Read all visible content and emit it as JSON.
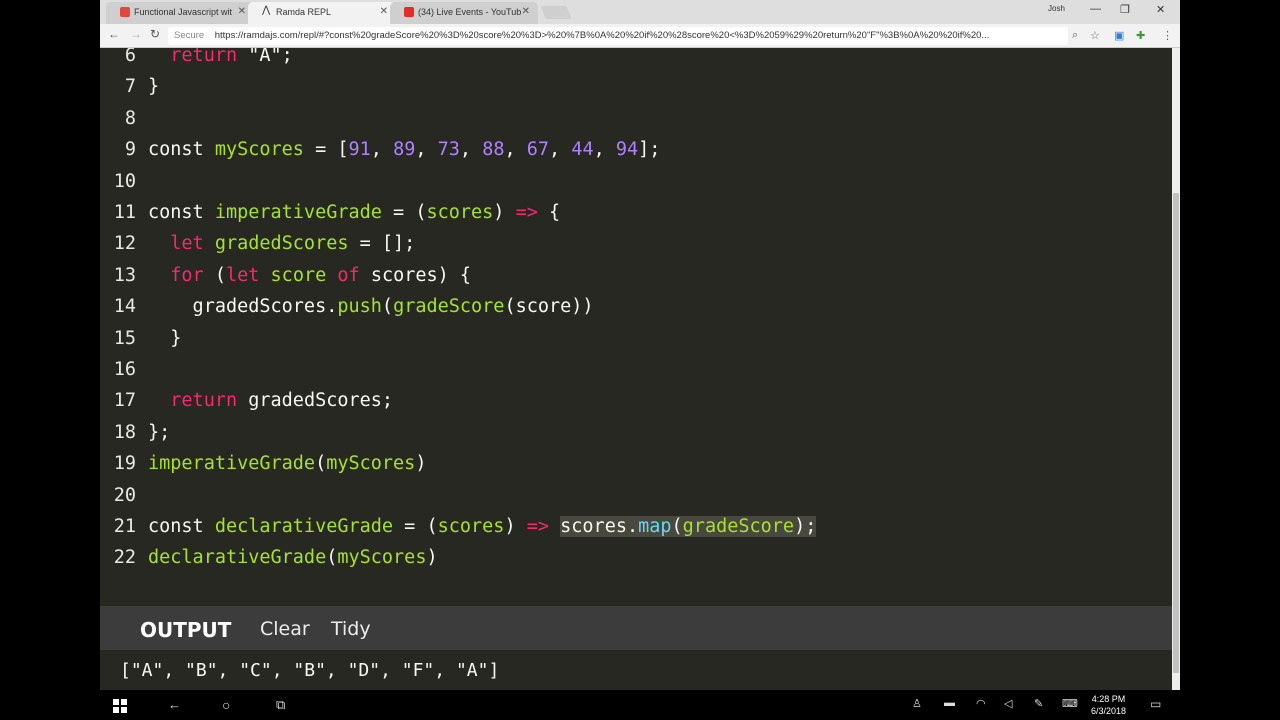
{
  "browser": {
    "tabs": [
      {
        "title": "Functional Javascript wit",
        "favicon_color": "#e0483e"
      },
      {
        "title": "Ramda REPL",
        "favicon_color": "#333333"
      },
      {
        "title": "(34) Live Events - YouTub",
        "favicon_color": "#e52d27"
      }
    ],
    "user_badge": "Josh",
    "secure_label": "Secure",
    "url": "https://ramdajs.com/repl/#?const%20gradeScore%20%3D%20score%20%3D>%20%7B%0A%20%20if%20%28score%20<%3D%2059%29%20return%20\"F\"%3B%0A%20%20if%20..."
  },
  "editor": {
    "lines": [
      {
        "n": "6",
        "tokens": [
          {
            "t": "  return ",
            "c": "kw"
          },
          {
            "t": "\"A\";",
            "c": "pl"
          }
        ]
      },
      {
        "n": "7",
        "tokens": [
          {
            "t": "}",
            "c": "pl"
          }
        ]
      },
      {
        "n": "8",
        "tokens": []
      },
      {
        "n": "9",
        "tokens": [
          {
            "t": "const ",
            "c": "pl"
          },
          {
            "t": "myScores",
            "c": "fn"
          },
          {
            "t": " = [",
            "c": "pl"
          },
          {
            "t": "91",
            "c": "num"
          },
          {
            "t": ", ",
            "c": "pl"
          },
          {
            "t": "89",
            "c": "num"
          },
          {
            "t": ", ",
            "c": "pl"
          },
          {
            "t": "73",
            "c": "num"
          },
          {
            "t": ", ",
            "c": "pl"
          },
          {
            "t": "88",
            "c": "num"
          },
          {
            "t": ", ",
            "c": "pl"
          },
          {
            "t": "67",
            "c": "num"
          },
          {
            "t": ", ",
            "c": "pl"
          },
          {
            "t": "44",
            "c": "num"
          },
          {
            "t": ", ",
            "c": "pl"
          },
          {
            "t": "94",
            "c": "num"
          },
          {
            "t": "];",
            "c": "pl"
          }
        ]
      },
      {
        "n": "10",
        "tokens": []
      },
      {
        "n": "11",
        "tokens": [
          {
            "t": "const ",
            "c": "pl"
          },
          {
            "t": "imperativeGrade",
            "c": "fn"
          },
          {
            "t": " = (",
            "c": "pl"
          },
          {
            "t": "scores",
            "c": "fn"
          },
          {
            "t": ") ",
            "c": "pl"
          },
          {
            "t": "=>",
            "c": "kw"
          },
          {
            "t": " {",
            "c": "pl"
          }
        ]
      },
      {
        "n": "12",
        "tokens": [
          {
            "t": "  let ",
            "c": "kw"
          },
          {
            "t": "gradedScores",
            "c": "fn"
          },
          {
            "t": " = [];",
            "c": "pl"
          }
        ]
      },
      {
        "n": "13",
        "tokens": [
          {
            "t": "  for",
            "c": "kw"
          },
          {
            "t": " (",
            "c": "pl"
          },
          {
            "t": "let ",
            "c": "kw"
          },
          {
            "t": "score",
            "c": "fn"
          },
          {
            "t": " of ",
            "c": "kw"
          },
          {
            "t": "scores",
            "c": "pl"
          },
          {
            "t": ") {",
            "c": "pl"
          }
        ]
      },
      {
        "n": "14",
        "tokens": [
          {
            "t": "    gradedScores.",
            "c": "pl"
          },
          {
            "t": "push",
            "c": "fn"
          },
          {
            "t": "(",
            "c": "pl"
          },
          {
            "t": "gradeScore",
            "c": "fn"
          },
          {
            "t": "(score))",
            "c": "pl"
          }
        ]
      },
      {
        "n": "15",
        "tokens": [
          {
            "t": "  }",
            "c": "pl"
          }
        ]
      },
      {
        "n": "16",
        "tokens": []
      },
      {
        "n": "17",
        "tokens": [
          {
            "t": "  return ",
            "c": "kw"
          },
          {
            "t": "gradedScores;",
            "c": "pl"
          }
        ]
      },
      {
        "n": "18",
        "tokens": [
          {
            "t": "};",
            "c": "pl"
          }
        ]
      },
      {
        "n": "19",
        "tokens": [
          {
            "t": "imperativeGrade",
            "c": "fn"
          },
          {
            "t": "(",
            "c": "pl"
          },
          {
            "t": "myScores",
            "c": "fn"
          },
          {
            "t": ")",
            "c": "pl"
          }
        ]
      },
      {
        "n": "20",
        "tokens": []
      },
      {
        "n": "21",
        "tokens": [
          {
            "t": "const ",
            "c": "pl"
          },
          {
            "t": "declarativeGrade",
            "c": "fn"
          },
          {
            "t": " = (",
            "c": "pl"
          },
          {
            "t": "scores",
            "c": "fn"
          },
          {
            "t": ") ",
            "c": "pl"
          },
          {
            "t": "=>",
            "c": "kw"
          },
          {
            "t": " ",
            "c": "pl"
          },
          {
            "t": "scores.",
            "c": "pl sel"
          },
          {
            "t": "map",
            "c": "meth sel"
          },
          {
            "t": "(",
            "c": "pl sel"
          },
          {
            "t": "gradeScore",
            "c": "fn sel"
          },
          {
            "t": ");",
            "c": "pl sel"
          }
        ]
      },
      {
        "n": "22",
        "tokens": [
          {
            "t": "declarativeGrade",
            "c": "fn"
          },
          {
            "t": "(",
            "c": "pl"
          },
          {
            "t": "myScores",
            "c": "fn"
          },
          {
            "t": ")",
            "c": "pl"
          }
        ]
      }
    ]
  },
  "output": {
    "title": "OUTPUT",
    "clear_label": "Clear",
    "tidy_label": "Tidy",
    "result": "[\"A\", \"B\", \"C\", \"B\", \"D\", \"F\", \"A\"]"
  },
  "taskbar": {
    "time": "4:28 PM",
    "date": "6/3/2018"
  }
}
